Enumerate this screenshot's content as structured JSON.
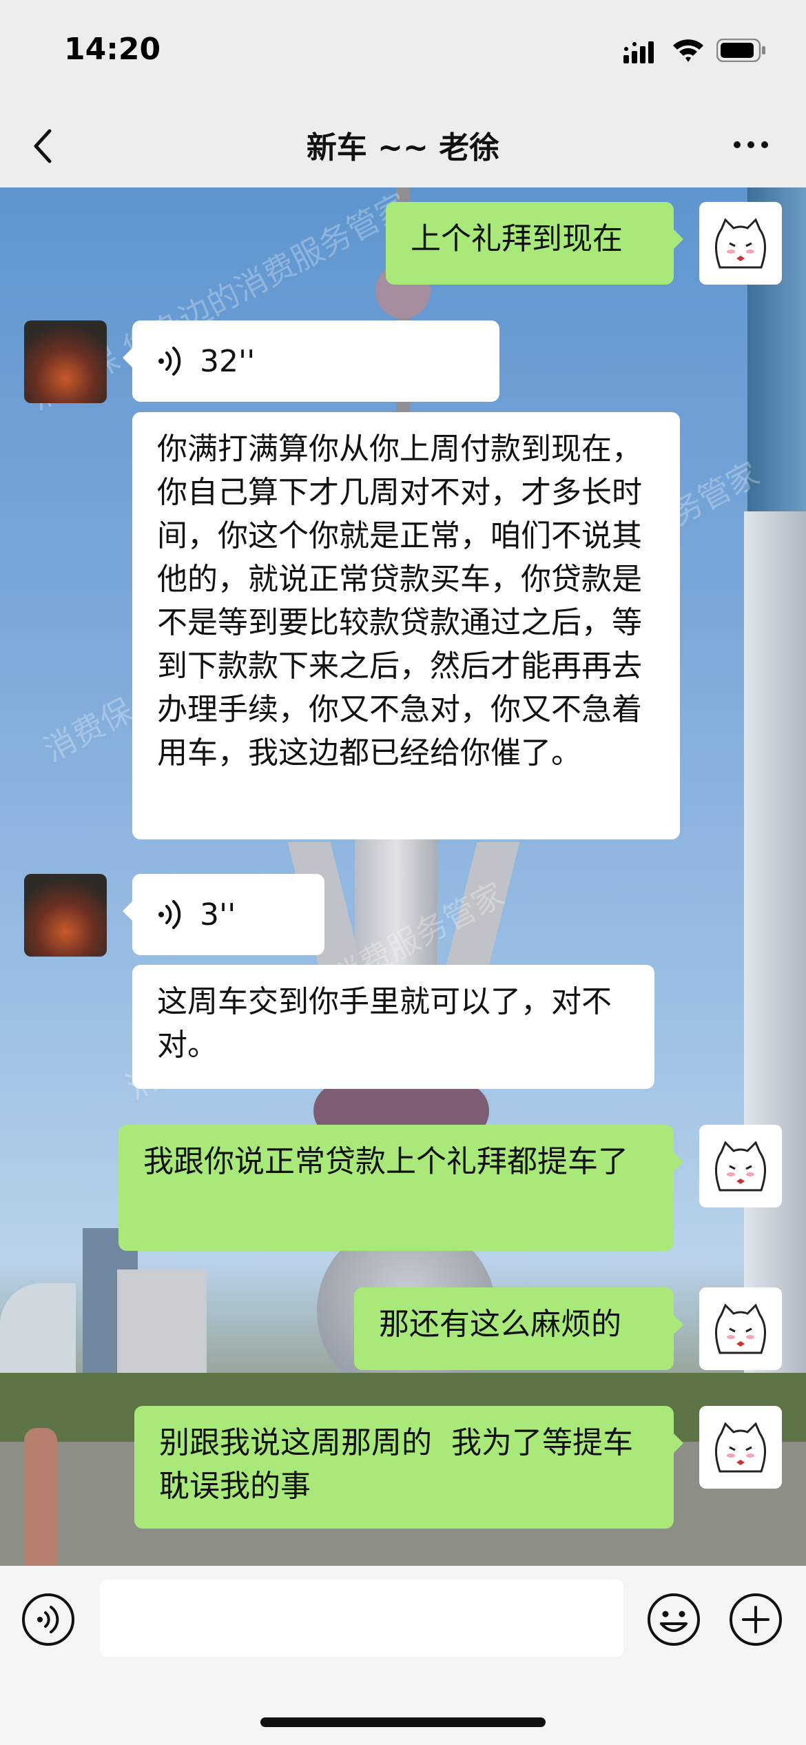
{
  "status_bar": {
    "time": "14:20"
  },
  "header": {
    "title": "新车 ~~ 老徐"
  },
  "watermark": "消费保 您身边的消费服务管家",
  "messages": [
    {
      "side": "out",
      "type": "text",
      "text": "上个礼拜到现在"
    },
    {
      "side": "in",
      "type": "voice",
      "duration": "32''"
    },
    {
      "side": "in",
      "type": "text",
      "text": "你满打满算你从你上周付款到现在，你自己算下才几周对不对，才多长时间，你这个你就是正常，咱们不说其他的，就说正常贷款买车，你贷款是不是等到要比较款贷款通过之后，等到下款款下来之后，然后才能再再去办理手续，你又不急对，你又不急着用车，我这边都已经给你催了。"
    },
    {
      "side": "in",
      "type": "voice",
      "duration": "3''"
    },
    {
      "side": "in",
      "type": "text",
      "text": "这周车交到你手里就可以了，对不对。"
    },
    {
      "side": "out",
      "type": "text",
      "text": "我跟你说正常贷款上个礼拜都提车了"
    },
    {
      "side": "out",
      "type": "text",
      "text": "那还有这么麻烦的"
    },
    {
      "side": "out",
      "type": "text",
      "text": "别跟我说这周那周的  我为了等提车耽误我的事"
    }
  ],
  "input": {
    "value": "",
    "placeholder": ""
  },
  "icons": {
    "back": "chevron-left-icon",
    "more": "more-dots-icon",
    "voice_toggle": "voice-input-icon",
    "emoji": "emoji-icon",
    "plus": "plus-icon"
  },
  "colors": {
    "outgoing_bubble": "#a9e97a",
    "incoming_bubble": "#ffffff",
    "bar_bg": "#ededed"
  }
}
